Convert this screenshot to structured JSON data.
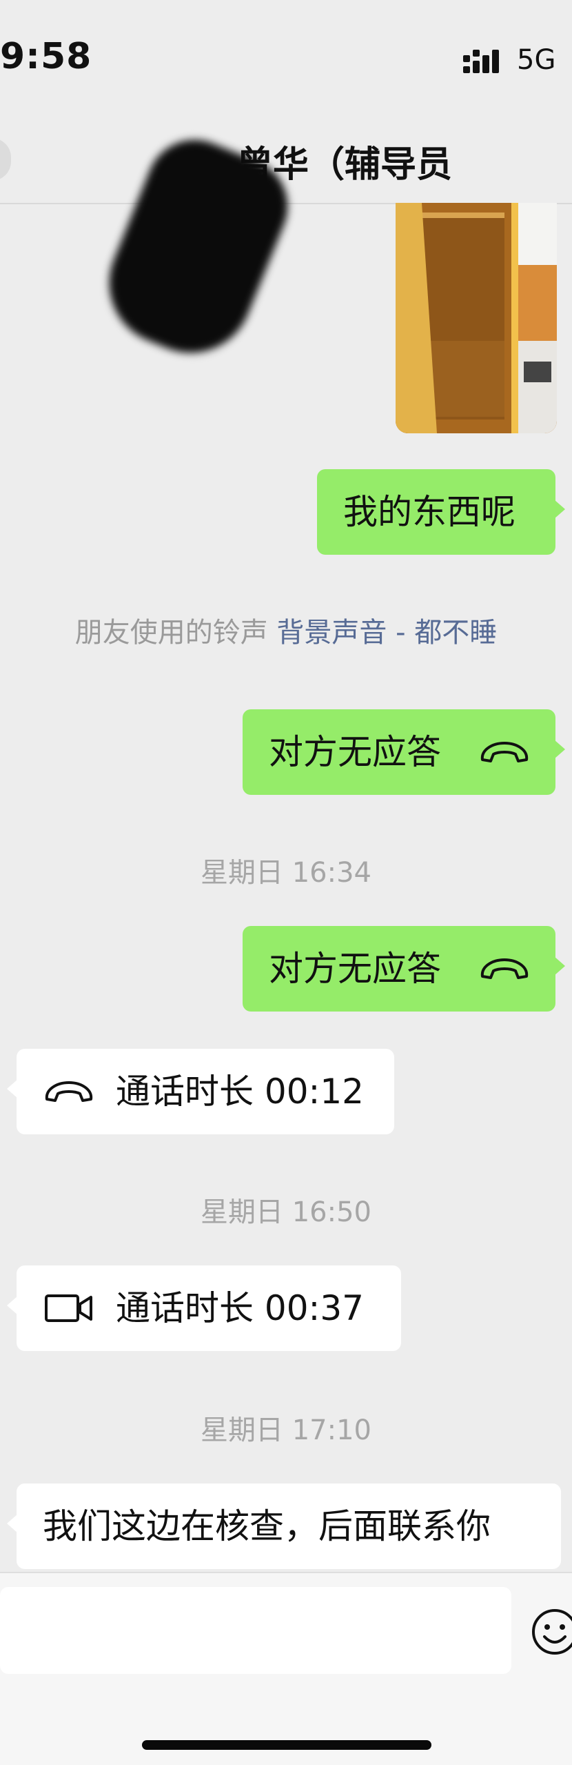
{
  "status_bar": {
    "time": "9:58",
    "network": "5G"
  },
  "header": {
    "title": "曾华（辅导员"
  },
  "messages": {
    "msg_out_1": "我的东西呢",
    "ringtone": {
      "prefix": "朋友使用的铃声",
      "song": "背景声音 - 都不睡"
    },
    "call_out_1": "对方无应答",
    "time_1": "星期日 16:34",
    "call_out_2": "对方无应答",
    "call_in_1": "通话时长 00:12",
    "time_2": "星期日 16:50",
    "video_in_1": "通话时长 00:37",
    "time_3": "星期日 17:10",
    "msg_in_1": "我们这边在核查，后面联系你"
  },
  "icons": {
    "phone": "phone-handset-icon",
    "video": "video-camera-icon",
    "emoji": "smiley-face-icon"
  },
  "colors": {
    "background": "#ededed",
    "outgoing_bubble": "#95ec69",
    "incoming_bubble": "#ffffff",
    "link": "#576b95"
  }
}
